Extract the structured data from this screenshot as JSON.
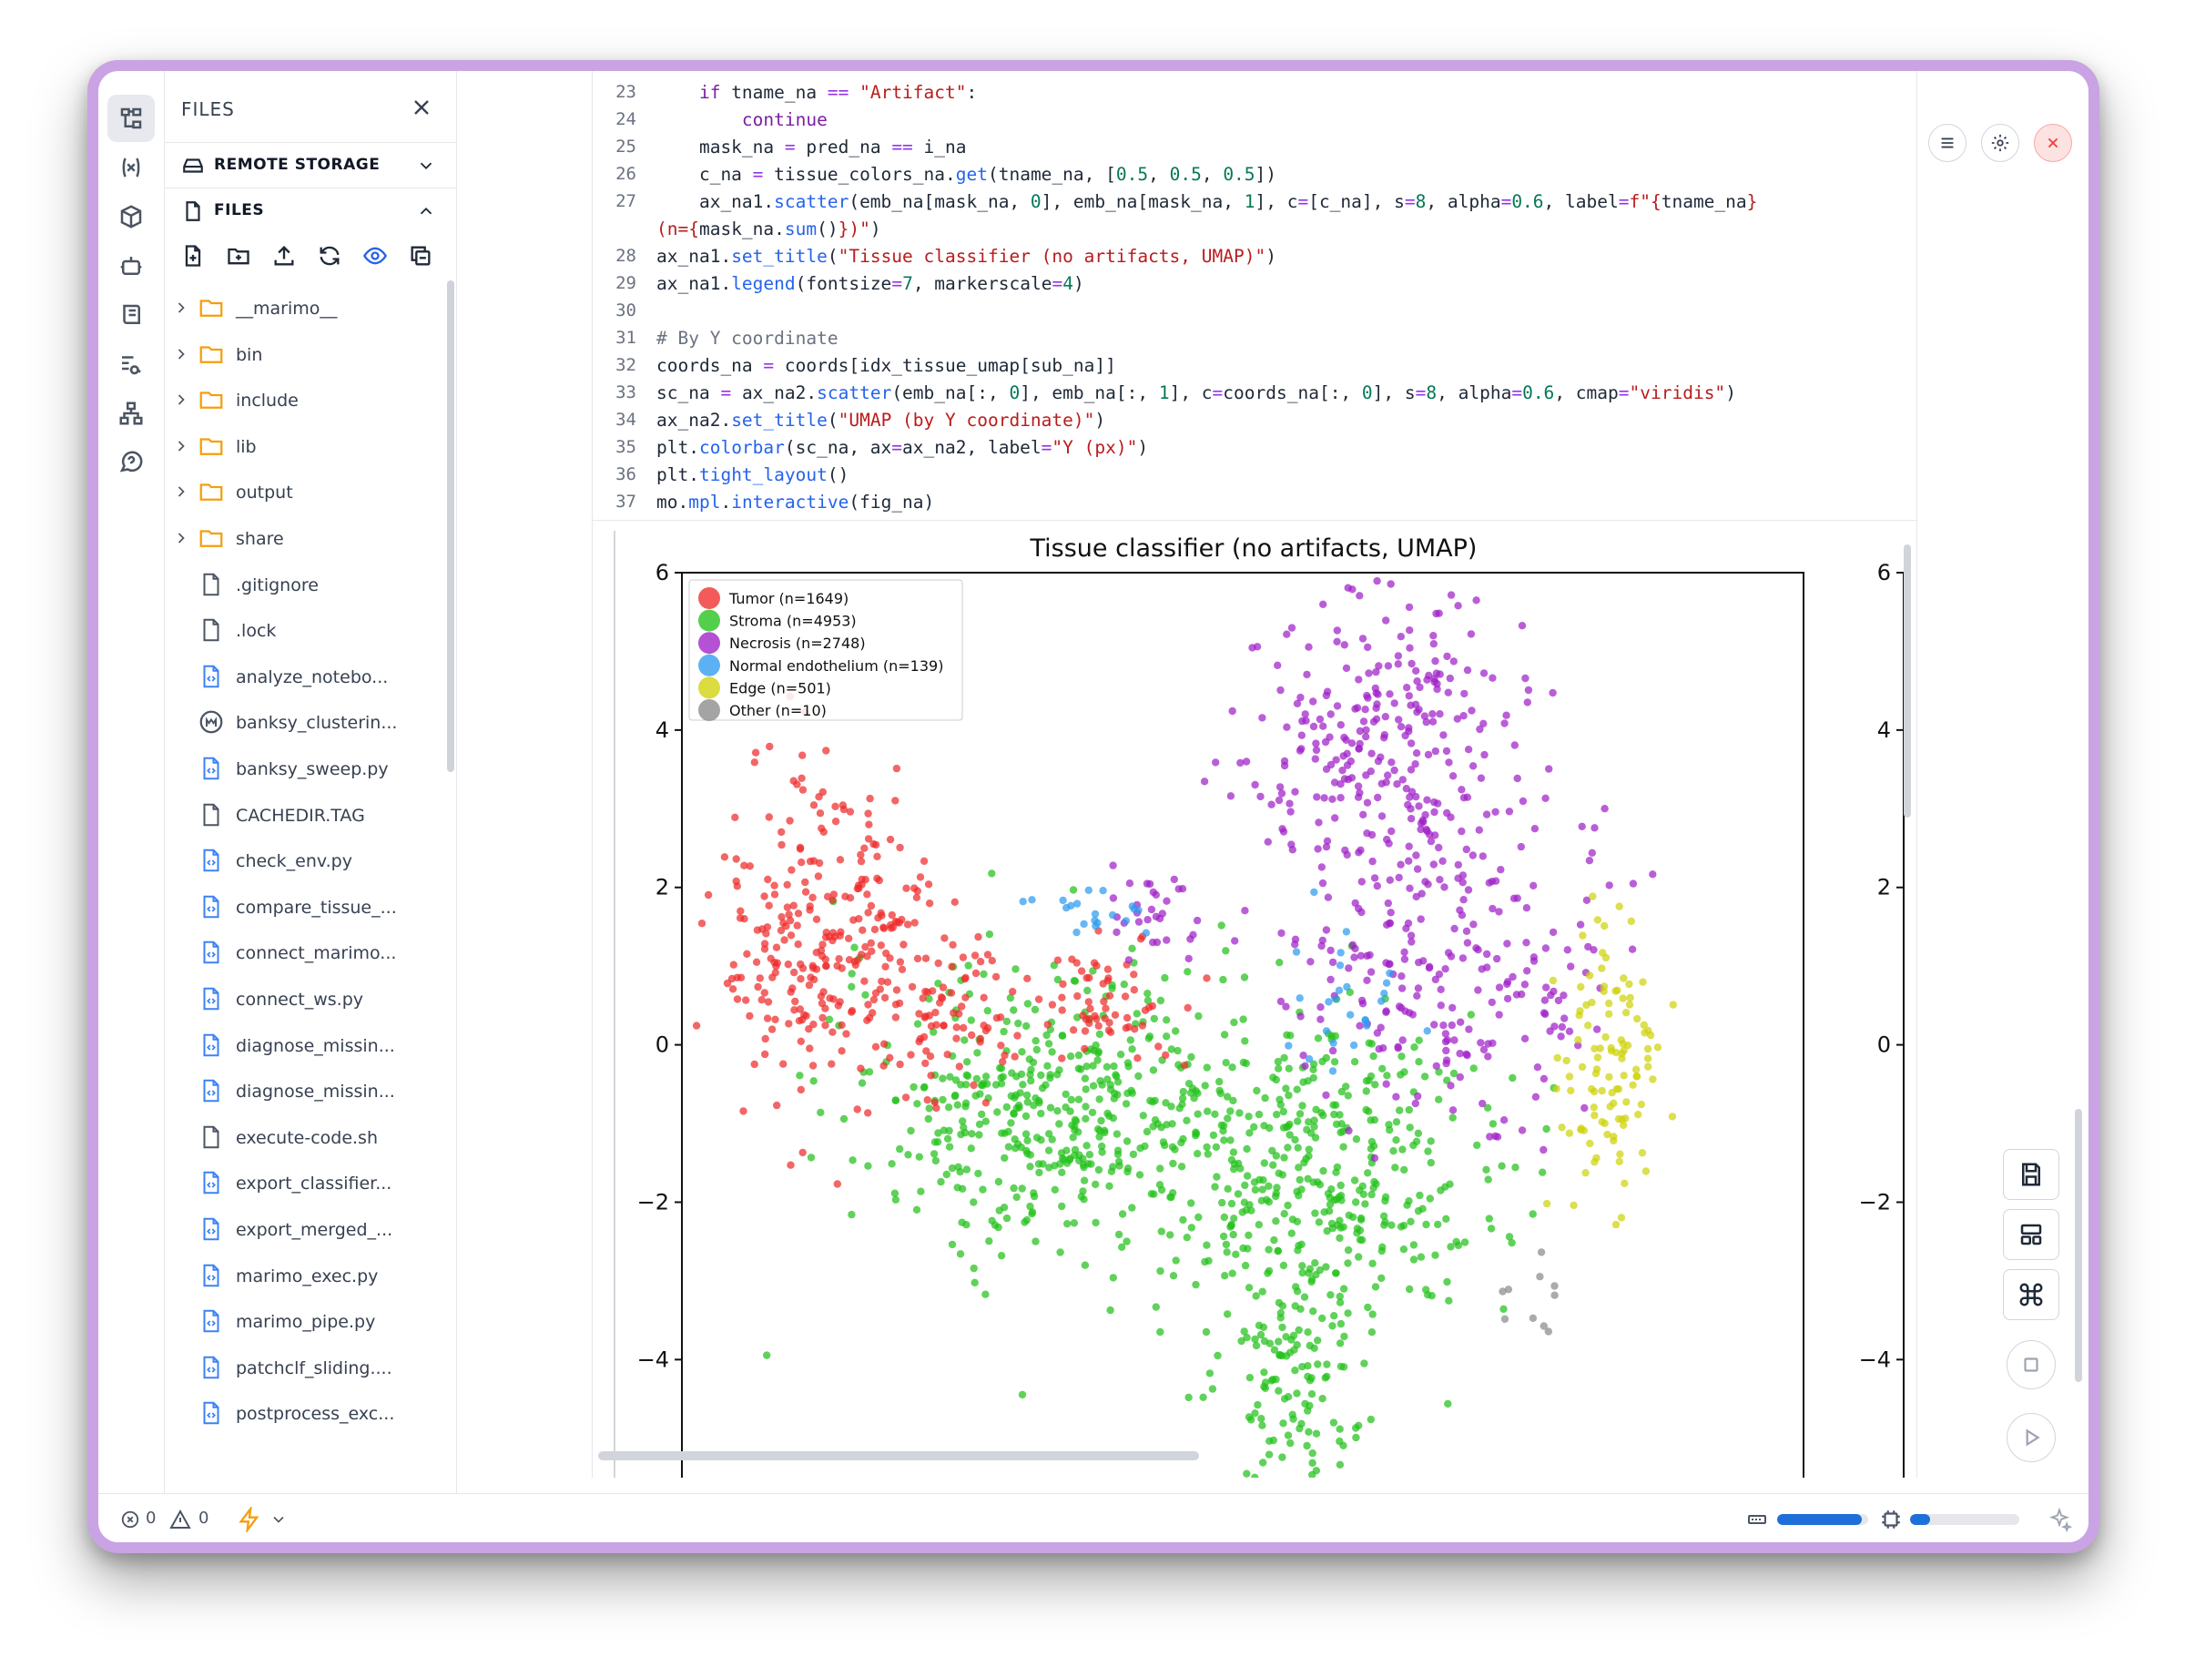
{
  "panel": {
    "title": "FILES",
    "remote_label": "REMOTE STORAGE",
    "files_label": "FILES"
  },
  "tree": [
    {
      "name": "__marimo__",
      "type": "folder"
    },
    {
      "name": "bin",
      "type": "folder"
    },
    {
      "name": "include",
      "type": "folder"
    },
    {
      "name": "lib",
      "type": "folder"
    },
    {
      "name": "output",
      "type": "folder"
    },
    {
      "name": "share",
      "type": "folder"
    },
    {
      "name": ".gitignore",
      "type": "file"
    },
    {
      "name": ".lock",
      "type": "file"
    },
    {
      "name": "analyze_notebo...",
      "type": "py"
    },
    {
      "name": "banksy_clusterin...",
      "type": "marimo"
    },
    {
      "name": "banksy_sweep.py",
      "type": "py"
    },
    {
      "name": "CACHEDIR.TAG",
      "type": "file"
    },
    {
      "name": "check_env.py",
      "type": "py"
    },
    {
      "name": "compare_tissue_...",
      "type": "py"
    },
    {
      "name": "connect_marimo...",
      "type": "py"
    },
    {
      "name": "connect_ws.py",
      "type": "py"
    },
    {
      "name": "diagnose_missin...",
      "type": "py"
    },
    {
      "name": "diagnose_missin...",
      "type": "py"
    },
    {
      "name": "execute-code.sh",
      "type": "file"
    },
    {
      "name": "export_classifier...",
      "type": "py"
    },
    {
      "name": "export_merged_...",
      "type": "py"
    },
    {
      "name": "marimo_exec.py",
      "type": "py"
    },
    {
      "name": "marimo_pipe.py",
      "type": "py"
    },
    {
      "name": "patchclf_sliding....",
      "type": "py"
    },
    {
      "name": "postprocess_exc...",
      "type": "py"
    }
  ],
  "code": {
    "line_numbers": [
      "23",
      "24",
      "25",
      "26",
      "27",
      "",
      "28",
      "29",
      "30",
      "31",
      "32",
      "33",
      "34",
      "35",
      "36",
      "37"
    ]
  },
  "chart_data": {
    "type": "scatter",
    "title": "Tissue classifier (no artifacts, UMAP)",
    "xlim": [
      -8.5,
      10
    ],
    "ylim": [
      -5.5,
      6
    ],
    "yticks": [
      6,
      4,
      2,
      0,
      -2,
      -4
    ],
    "ytick_labels": [
      "6",
      "4",
      "2",
      "0",
      "−2",
      "−4"
    ],
    "legend_position": "top-left",
    "series": [
      {
        "name": "Tumor (n=1649)",
        "color": "#ef2b2b",
        "clusters": [
          {
            "cx": -6.2,
            "cy": 1.4,
            "sx": 0.8,
            "sy": 1.0,
            "n": 260
          },
          {
            "cx": -4.2,
            "cy": 0.5,
            "sx": 0.6,
            "sy": 0.6,
            "n": 90
          },
          {
            "cx": -1.5,
            "cy": 0.6,
            "sx": 0.7,
            "sy": 0.4,
            "n": 60
          }
        ]
      },
      {
        "name": "Stroma (n=4953)",
        "color": "#22c11a",
        "clusters": [
          {
            "cx": -2.5,
            "cy": -0.8,
            "sx": 1.7,
            "sy": 0.9,
            "n": 420
          },
          {
            "cx": 1.8,
            "cy": -1.6,
            "sx": 1.5,
            "sy": 1.1,
            "n": 420
          },
          {
            "cx": 1.6,
            "cy": -4.2,
            "sx": 0.6,
            "sy": 0.9,
            "n": 120
          }
        ]
      },
      {
        "name": "Necrosis (n=2748)",
        "color": "#a020c8",
        "clusters": [
          {
            "cx": 3.2,
            "cy": 3.9,
            "sx": 1.2,
            "sy": 0.9,
            "n": 260
          },
          {
            "cx": 4.2,
            "cy": 1.0,
            "sx": 1.3,
            "sy": 1.0,
            "n": 240
          },
          {
            "cx": -0.8,
            "cy": 1.7,
            "sx": 0.4,
            "sy": 0.3,
            "n": 30
          }
        ]
      },
      {
        "name": "Normal endothelium (n=139)",
        "color": "#2e9bf0",
        "clusters": [
          {
            "cx": -1.6,
            "cy": 1.7,
            "sx": 0.4,
            "sy": 0.15,
            "n": 20
          },
          {
            "cx": 2.5,
            "cy": 0.6,
            "sx": 0.6,
            "sy": 0.6,
            "n": 25
          }
        ]
      },
      {
        "name": "Edge (n=501)",
        "color": "#cfd20a",
        "clusters": [
          {
            "cx": 6.8,
            "cy": -0.3,
            "sx": 0.45,
            "sy": 0.9,
            "n": 110
          }
        ]
      },
      {
        "name": "Other (n=10)",
        "color": "#8a8a8a",
        "clusters": [
          {
            "cx": 5.5,
            "cy": -3.5,
            "sx": 0.3,
            "sy": 0.3,
            "n": 10
          }
        ]
      }
    ],
    "colorbar_yticks": [
      "6",
      "4",
      "2",
      "0",
      "−2",
      "−4"
    ]
  },
  "status": {
    "errors": "0",
    "warnings": "0",
    "memory_fill": 0.93,
    "cpu_fill": 0.18
  },
  "colors": {
    "accent": "#1e6fd9",
    "frame": "#c9a3e3"
  }
}
